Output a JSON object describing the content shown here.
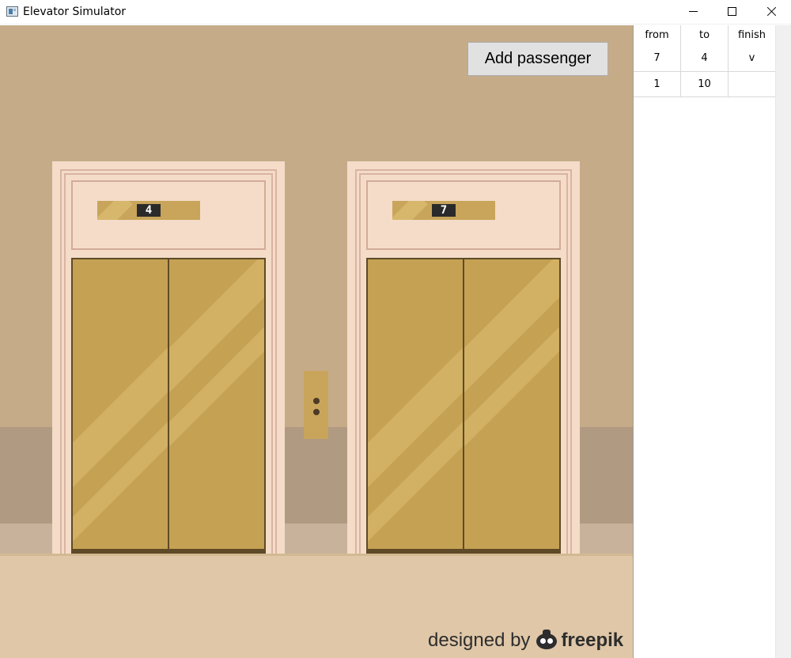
{
  "window": {
    "title": "Elevator Simulator",
    "app_icon": "window-app-icon",
    "controls": [
      "minimize-icon",
      "maximize-icon",
      "close-icon"
    ]
  },
  "toolbar": {
    "add_label": "Add passenger"
  },
  "elevators": [
    {
      "floor": "4"
    },
    {
      "floor": "7"
    }
  ],
  "credit": {
    "prefix": "designed by",
    "brand": "freepik"
  },
  "table": {
    "headers": [
      "from",
      "to",
      "finish"
    ],
    "rows": [
      [
        "7",
        "4",
        "v"
      ],
      [
        "1",
        "10",
        ""
      ]
    ]
  },
  "colors": {
    "wall": "#c5ab88",
    "door_gold": "#c5a153",
    "frame": "#f4dcc9",
    "floor": "#dfc7a8"
  }
}
